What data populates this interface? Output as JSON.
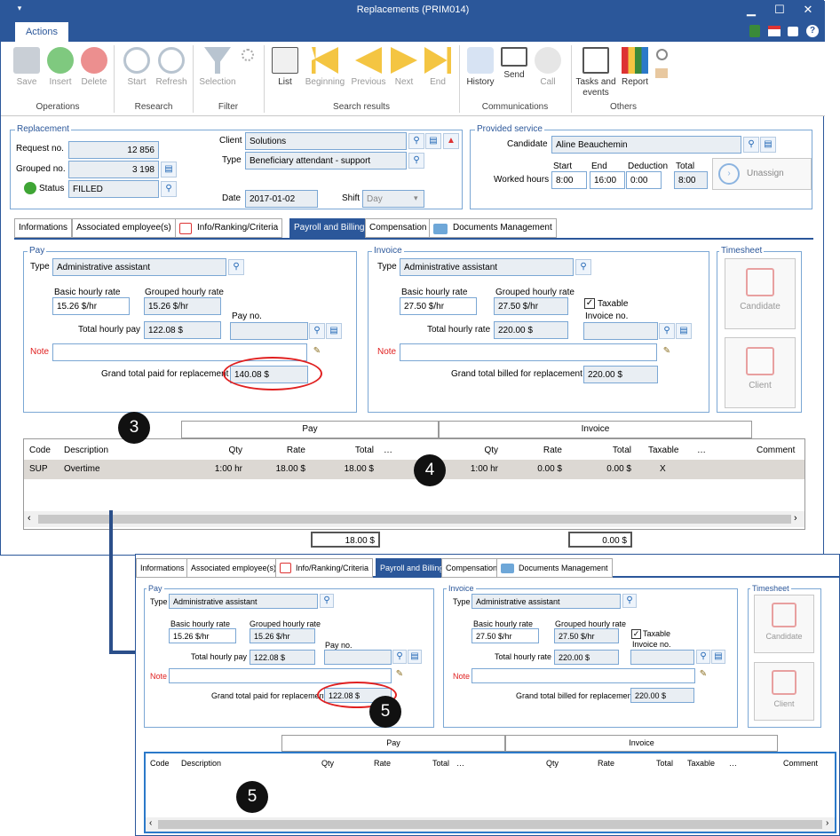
{
  "window": {
    "title": "Replacements (PRIM014)",
    "min": "▁",
    "max": "☐",
    "close": "✕"
  },
  "ribbon": {
    "tab": "Actions",
    "buttons": [
      {
        "label": "Save"
      },
      {
        "label": "Insert"
      },
      {
        "label": "Delete"
      },
      {
        "label": "Start"
      },
      {
        "label": "Refresh"
      },
      {
        "label": "Selection"
      },
      {
        "label": "List"
      },
      {
        "label": "Beginning"
      },
      {
        "label": "Previous"
      },
      {
        "label": "Next"
      },
      {
        "label": "End"
      },
      {
        "label": "History"
      },
      {
        "label": "Send"
      },
      {
        "label": "Call"
      },
      {
        "label": "Tasks and events"
      },
      {
        "label": "Report"
      }
    ],
    "groups": [
      "Operations",
      "Research",
      "Filter",
      "Search results",
      "Communications",
      "Others"
    ]
  },
  "replacement": {
    "legend": "Replacement",
    "request_label": "Request no.",
    "request_value": "12 856",
    "grouped_label": "Grouped no.",
    "grouped_value": "3 198",
    "status_label": "Status",
    "status_value": "FILLED",
    "client_label": "Client",
    "client_value": "Solutions",
    "type_label": "Type",
    "type_value": "Beneficiary attendant - support",
    "date_label": "Date",
    "date_value": "2017-01-02",
    "shift_label": "Shift",
    "shift_value": "Day"
  },
  "provided": {
    "legend": "Provided service",
    "candidate_label": "Candidate",
    "candidate_value": "Aline Beauchemin",
    "worked_label": "Worked hours",
    "start_label": "Start",
    "start_value": "8:00",
    "end_label": "End",
    "end_value": "16:00",
    "deduction_label": "Deduction",
    "deduction_value": "0:00",
    "total_label": "Total",
    "total_value": "8:00",
    "unassign_label": "Unassign"
  },
  "tabs": [
    "Informations",
    "Associated employee(s)",
    "Info/Ranking/Criteria",
    "Payroll and Billing",
    "Compensation",
    "Documents Management"
  ],
  "pay": {
    "legend": "Pay",
    "type_label": "Type",
    "type_value": "Administrative assistant",
    "basic_label": "Basic hourly rate",
    "basic_value": "15.26 $/hr",
    "grouped_label": "Grouped hourly rate",
    "grouped_value": "15.26 $/hr",
    "total_label": "Total hourly pay",
    "total_value": "122.08 $",
    "payno_label": "Pay no.",
    "note_label": "Note",
    "grand_label": "Grand total paid for replacement",
    "grand_value": "140.08 $"
  },
  "invoice": {
    "legend": "Invoice",
    "type_label": "Type",
    "type_value": "Administrative assistant",
    "basic_label": "Basic hourly rate",
    "basic_value": "27.50 $/hr",
    "grouped_label": "Grouped hourly rate",
    "grouped_value": "27.50 $/hr",
    "taxable_label": "Taxable",
    "invno_label": "Invoice no.",
    "total_label": "Total hourly rate",
    "total_value": "220.00 $",
    "note_label": "Note",
    "grand_label": "Grand total billed for replacement",
    "grand_value": "220.00 $"
  },
  "timesheet": {
    "legend": "Timesheet",
    "candidate": "Candidate",
    "client": "Client"
  },
  "grid": {
    "group_pay": "Pay",
    "group_invoice": "Invoice",
    "headers": [
      "Code",
      "Description",
      "Qty",
      "Rate",
      "Total",
      "…",
      "Qty",
      "Rate",
      "Total",
      "Taxable",
      "…",
      "Comment"
    ],
    "rows": [
      [
        "SUP",
        "Overtime",
        "1:00 hr",
        "18.00 $",
        "18.00 $",
        "",
        "1:00 hr",
        "0.00 $",
        "0.00 $",
        "X",
        "",
        ""
      ]
    ],
    "total_pay": "18.00 $",
    "total_invoice": "0.00 $"
  },
  "inset": {
    "tabs": [
      "Informations",
      "Associated employee(s)",
      "Info/Ranking/Criteria",
      "Payroll and Billing",
      "Compensation",
      "Documents Management"
    ],
    "pay": {
      "legend": "Pay",
      "type_label": "Type",
      "type_value": "Administrative assistant",
      "basic_label": "Basic hourly rate",
      "basic_value": "15.26 $/hr",
      "grouped_label": "Grouped hourly rate",
      "grouped_value": "15.26 $/hr",
      "total_label": "Total hourly pay",
      "total_value": "122.08 $",
      "payno_label": "Pay no.",
      "note_label": "Note",
      "grand_label": "Grand total paid for replacement",
      "grand_value": "122.08 $"
    },
    "invoice": {
      "legend": "Invoice",
      "type_label": "Type",
      "type_value": "Administrative assistant",
      "basic_label": "Basic hourly rate",
      "basic_value": "27.50 $/hr",
      "grouped_label": "Grouped hourly rate",
      "grouped_value": "27.50 $/hr",
      "taxable_label": "Taxable",
      "invno_label": "Invoice no.",
      "total_label": "Total hourly rate",
      "total_value": "220.00 $",
      "note_label": "Note",
      "grand_label": "Grand total billed for replacement",
      "grand_value": "220.00 $"
    },
    "timesheet": {
      "legend": "Timesheet",
      "candidate": "Candidate",
      "client": "Client"
    },
    "grid": {
      "group_pay": "Pay",
      "group_invoice": "Invoice",
      "headers": [
        "Code",
        "Description",
        "Qty",
        "Rate",
        "Total",
        "…",
        "Qty",
        "Rate",
        "Total",
        "Taxable",
        "…",
        "Comment"
      ]
    }
  },
  "callouts": {
    "c3": "3",
    "c4": "4",
    "c5a": "5",
    "c5b": "5"
  },
  "colors": {
    "accent": "#2b579a",
    "highlight_ring": "#e02020"
  }
}
